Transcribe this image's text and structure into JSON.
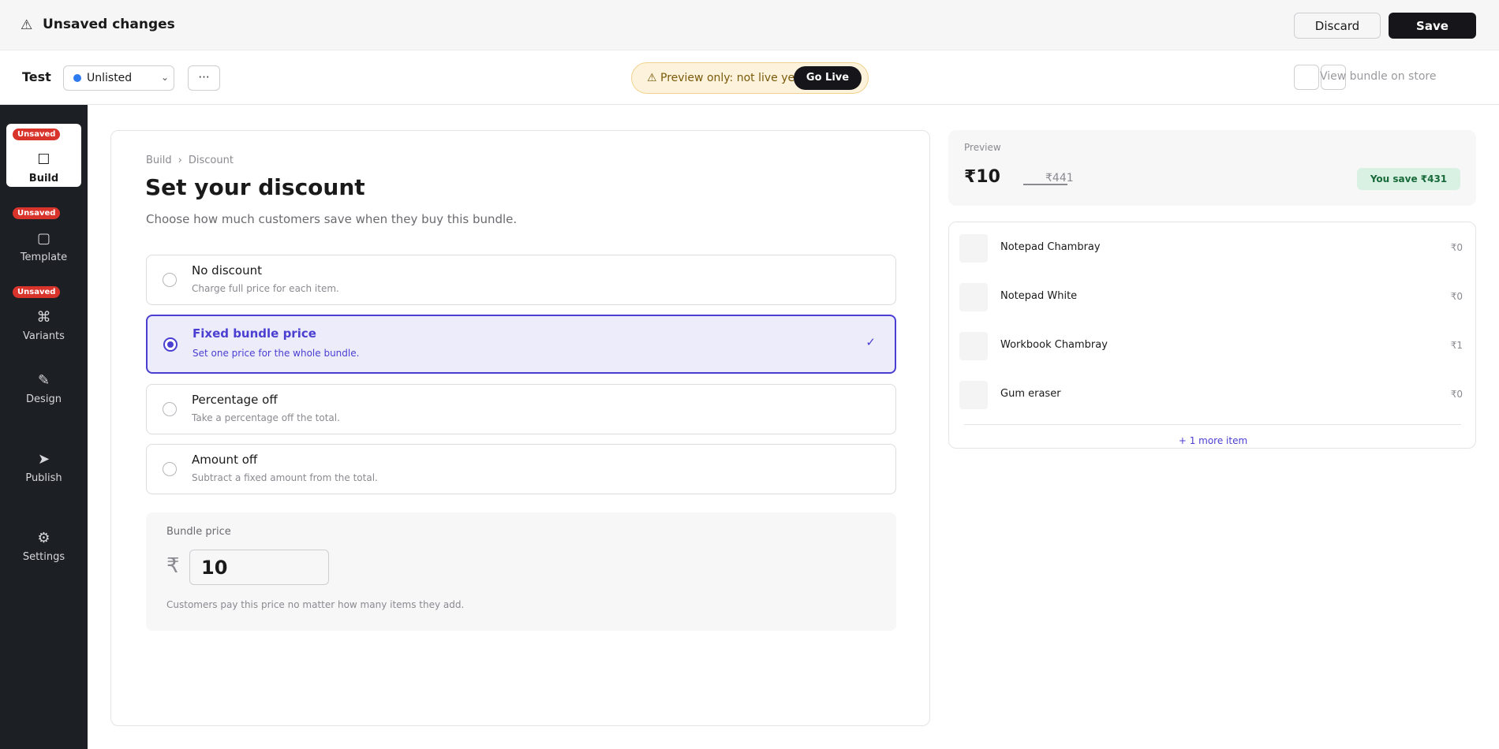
{
  "topbar": {
    "title": "Unsaved changes",
    "warn_icon": "⚠",
    "discard_label": "Discard",
    "save_label": "Save"
  },
  "subbar": {
    "bundle_name": "Test",
    "status": {
      "selected": "Unlisted",
      "dot_color": "#2d7bf0"
    },
    "more_label": "···",
    "preview_notice": "⚠ Preview only: not live yet",
    "go_live_label": "Go Live",
    "view_store_label": "View bundle on store"
  },
  "sidebar": {
    "items": [
      {
        "label": "Build",
        "icon": "☐",
        "icon_name": "build-icon",
        "badge": "Unsaved",
        "active": true
      },
      {
        "label": "Template",
        "icon": "▢",
        "icon_name": "template-icon",
        "badge": "Unsaved",
        "active": false
      },
      {
        "label": "Variants",
        "icon": "⌘",
        "icon_name": "variants-icon",
        "badge": "Unsaved",
        "active": false
      },
      {
        "label": "Design",
        "icon": "✎",
        "icon_name": "pencil-icon",
        "badge": "",
        "active": false
      },
      {
        "label": "Publish",
        "icon": "➤",
        "icon_name": "send-icon",
        "badge": "",
        "active": false
      },
      {
        "label": "Settings",
        "icon": "⚙",
        "icon_name": "gear-icon",
        "badge": "",
        "active": false
      }
    ]
  },
  "main": {
    "breadcrumb": [
      "Build",
      "Discount"
    ],
    "breadcrumb_sep": "›",
    "title": "Set your discount",
    "subtitle": "Choose how much customers save when they buy this bundle.",
    "options": [
      {
        "title": "No discount",
        "desc": "Charge full price for each item.",
        "selected": false
      },
      {
        "title": "Fixed bundle price",
        "desc": "Set one price for the whole bundle.",
        "selected": true
      },
      {
        "title": "Percentage off",
        "desc": "Take a percentage off the total.",
        "selected": false
      },
      {
        "title": "Amount off",
        "desc": "Subtract a fixed amount from the total.",
        "selected": false
      }
    ],
    "check_mark": "✓",
    "price_panel": {
      "label": "Bundle price",
      "currency": "₹",
      "value": "10",
      "note": "Customers pay this price no matter how many items they add."
    }
  },
  "preview": {
    "label": "Preview",
    "new_price": "₹10",
    "old_price": "₹441",
    "savings": "You save ₹431"
  },
  "items": {
    "list": [
      {
        "name": "Notepad Chambray",
        "price": "₹0"
      },
      {
        "name": "Notepad White",
        "price": "₹0"
      },
      {
        "name": "Workbook Chambray",
        "price": "₹1"
      },
      {
        "name": "Gum eraser",
        "price": "₹0"
      }
    ],
    "more_label": "+ 1 more item"
  }
}
